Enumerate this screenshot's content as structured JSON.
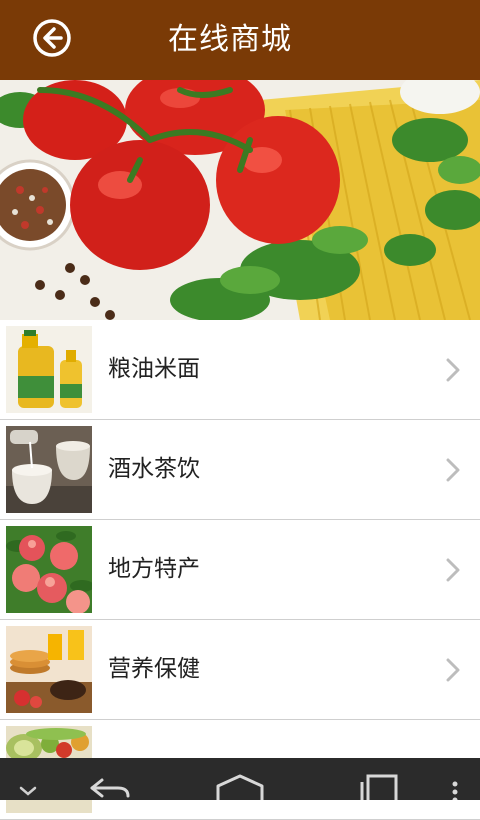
{
  "header": {
    "title": "在线商城",
    "back_icon": "arrow-left-circle-icon",
    "background": "#7a3a06"
  },
  "categories": [
    {
      "label": "粮油米面",
      "icon": "chevron-right-icon"
    },
    {
      "label": "酒水茶饮",
      "icon": "chevron-right-icon"
    },
    {
      "label": "地方特产",
      "icon": "chevron-right-icon"
    },
    {
      "label": "营养保健",
      "icon": "chevron-right-icon"
    }
  ],
  "system_nav": {
    "icons": [
      "chevron-down-icon",
      "back-icon",
      "home-icon",
      "recent-apps-icon",
      "menu-dots-icon"
    ]
  }
}
